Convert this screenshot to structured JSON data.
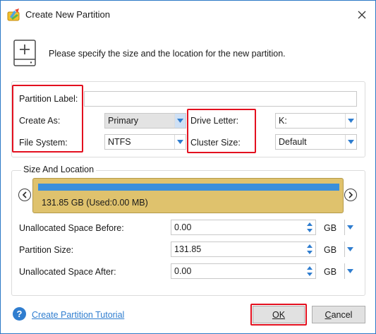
{
  "window": {
    "title": "Create New Partition"
  },
  "header": {
    "instruction": "Please specify the size and the location for the new partition."
  },
  "form": {
    "partition_label": {
      "label": "Partition Label:",
      "value": ""
    },
    "create_as": {
      "label": "Create As:",
      "value": "Primary"
    },
    "file_system": {
      "label": "File System:",
      "value": "NTFS"
    },
    "drive_letter": {
      "label": "Drive Letter:",
      "value": "K:"
    },
    "cluster_size": {
      "label": "Cluster Size:",
      "value": "Default"
    }
  },
  "size_location": {
    "legend": "Size And Location",
    "bar_text": "131.85 GB (Used:0.00 MB)",
    "used_fraction": 0.0,
    "fields": [
      {
        "label": "Unallocated Space Before:",
        "value": "0.00",
        "unit": "GB"
      },
      {
        "label": "Partition Size:",
        "value": "131.85",
        "unit": "GB"
      },
      {
        "label": "Unallocated Space After:",
        "value": "0.00",
        "unit": "GB"
      }
    ]
  },
  "footer": {
    "help_icon": "?",
    "tutorial_link": "Create Partition Tutorial",
    "ok_label": "OK",
    "cancel_label_first": "C",
    "cancel_label_rest": "ancel"
  },
  "icons": {
    "app": "app-logo-icon",
    "close": "close-icon",
    "disk_add": "disk-add-icon",
    "dropdown": "chevron-down-icon",
    "left": "chevron-left-icon",
    "right": "chevron-right-icon"
  },
  "colors": {
    "highlight": "#e3101f",
    "partition_bar": "#dfc26d",
    "partition_fill": "#3a8fdb",
    "link": "#2f7dcf",
    "window_border": "#2b78c6"
  }
}
